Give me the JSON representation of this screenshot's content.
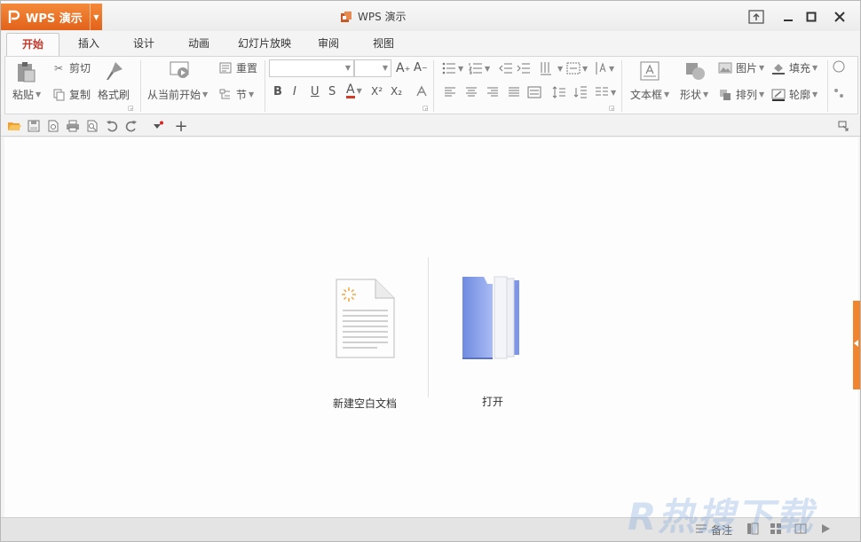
{
  "app": {
    "button_label": "WPS 演示",
    "window_title": "WPS 演示",
    "brand_color": "#e8702a"
  },
  "tabs": [
    {
      "label": "开始",
      "active": true
    },
    {
      "label": "插入"
    },
    {
      "label": "设计"
    },
    {
      "label": "动画"
    },
    {
      "label": "幻灯片放映"
    },
    {
      "label": "审阅"
    },
    {
      "label": "视图"
    }
  ],
  "ribbon": {
    "paste": "粘贴",
    "cut": "剪切",
    "copy": "复制",
    "format_painter": "格式刷",
    "from_current": "从当前开始",
    "reset": "重置",
    "section": "节",
    "bold": "B",
    "italic": "I",
    "underline": "U",
    "strike": "S",
    "font_color": "A",
    "superscript": "X²",
    "subscript": "X₂",
    "textbox": "文本框",
    "shape": "形状",
    "picture": "图片",
    "arrange": "排列",
    "fill": "填充",
    "outline": "轮廓"
  },
  "main": {
    "new_blank": "新建空白文档",
    "open": "打开"
  },
  "status": {
    "notes": "备注"
  },
  "watermark": "R热搜下载"
}
